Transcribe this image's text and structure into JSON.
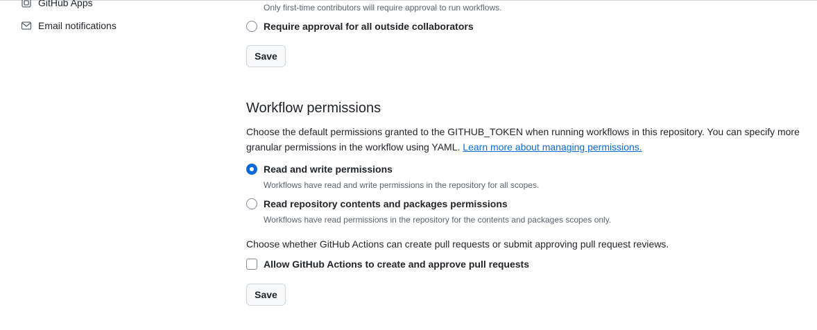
{
  "sidebar": {
    "items": [
      {
        "label": "GitHub Apps",
        "icon": "apps-icon"
      },
      {
        "label": "Email notifications",
        "icon": "mail-icon"
      }
    ]
  },
  "fork_approval": {
    "prev_note": "Only first-time contributors will require approval to run workflows.",
    "option_all_outside": "Require approval for all outside collaborators",
    "save_label": "Save"
  },
  "workflow_permissions": {
    "title": "Workflow permissions",
    "description_1": "Choose the default permissions granted to the GITHUB_TOKEN when running workflows in this repository. You can specify more granular permissions in the workflow using YAML.",
    "link_text": "Learn more about managing permissions.",
    "options": [
      {
        "label": "Read and write permissions",
        "note": "Workflows have read and write permissions in the repository for all scopes.",
        "checked": true
      },
      {
        "label": "Read repository contents and packages permissions",
        "note": "Workflows have read permissions in the repository for the contents and packages scopes only.",
        "checked": false
      }
    ],
    "pr_question": "Choose whether GitHub Actions can create pull requests or submit approving pull request reviews.",
    "pr_checkbox_label": "Allow GitHub Actions to create and approve pull requests",
    "pr_checkbox_checked": false,
    "save_label": "Save"
  },
  "colors": {
    "accent": "#0969da",
    "text": "#1f2328",
    "muted": "#59636e",
    "border": "#d0d7de"
  }
}
